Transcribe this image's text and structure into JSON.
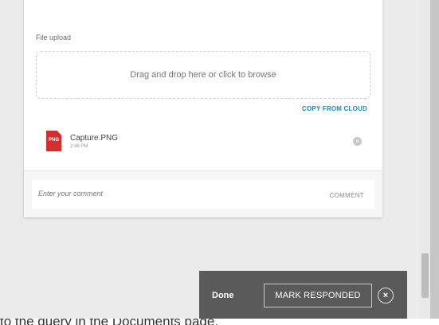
{
  "upload": {
    "label": "File upload",
    "dropzone_text": "Drag and drop here or click to browse",
    "copy_from_cloud": "COPY FROM CLOUD"
  },
  "file": {
    "type_badge": "PNG",
    "name": "Capture.PNG",
    "time": "2:48 PM",
    "remove_icon": "close-circle-icon"
  },
  "comment": {
    "placeholder": "Enter your comment",
    "button": "COMMENT"
  },
  "toolbar": {
    "done": "Done",
    "mark_responded": "MARK RESPONDED",
    "close_glyph": "×"
  },
  "bottom": {
    "text": "to the query in the Documents page."
  },
  "colors": {
    "accent": "#1a8ac4",
    "file_icon": "#d32f2f",
    "toolbar_bg": "#5a5a5a"
  }
}
